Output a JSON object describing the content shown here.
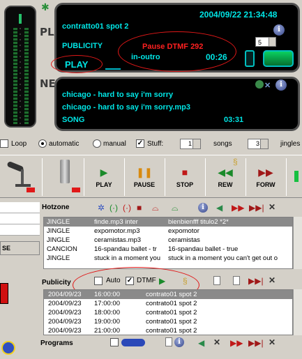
{
  "side_label_top": "PLAY",
  "side_label_bottom": "NEXT",
  "current": {
    "title": "contratto01 spot 2",
    "datetime": "2004/09/22 21:34:48",
    "category": "PUBLICITY",
    "status_alert": "Pause DTMF 292",
    "mode": "in-outro",
    "time": "00:26",
    "state": "PLAY",
    "spin_value": "5"
  },
  "next": {
    "title": "chicago - hard to say i'm sorry",
    "file": "chicago - hard to say i'm sorry.mp3",
    "category": "SONG",
    "time": "03:31"
  },
  "options": {
    "loop": "Loop",
    "automatic": "automatic",
    "manual": "manual",
    "stuff": "Stuff:",
    "songs_value": "1",
    "songs_label": "songs",
    "jingles_value": "3",
    "jingles_label": "jingles"
  },
  "transport": {
    "play": "PLAY",
    "pause": "PAUSE",
    "stop": "STOP",
    "rew": "REW",
    "forw": "FORW"
  },
  "left_panel": {
    "button": "SE"
  },
  "hotzone": {
    "title": "Hotzone",
    "rows": [
      {
        "type": "JINGLE",
        "file": "finde.mp3 inter",
        "title": "bienbienfff titulo2 *2*"
      },
      {
        "type": "JINGLE",
        "file": "expomotor.mp3",
        "title": "expomotor"
      },
      {
        "type": "JINGLE",
        "file": "ceramistas.mp3",
        "title": "ceramistas"
      },
      {
        "type": "CANCION",
        "file": "16-spandau ballet - tr",
        "title": "16-spandau ballet - true"
      },
      {
        "type": "JINGLE",
        "file": "stuck in a moment you",
        "title": "stuck in a moment you can't get out o"
      }
    ]
  },
  "publicity": {
    "title": "Publicity",
    "auto_label": "Auto",
    "dtmf_label": "DTMF",
    "rows": [
      {
        "date": "2004/09/23",
        "time": "16:00:00",
        "title": "contrato01 spot 2"
      },
      {
        "date": "2004/09/23",
        "time": "17:00:00",
        "title": "contrato01 spot 2"
      },
      {
        "date": "2004/09/23",
        "time": "18:00:00",
        "title": "contrato01 spot 2"
      },
      {
        "date": "2004/09/23",
        "time": "19:00:00",
        "title": "contrato01 spot 2"
      },
      {
        "date": "2004/09/23",
        "time": "21:00:00",
        "title": "contrato01 spot 2"
      }
    ]
  },
  "programs": {
    "title": "Programs"
  },
  "colors": {
    "display_text": "#00e5e5",
    "alert": "#ff2020",
    "play_green": "#1a8a2a",
    "stop_red": "#c01818"
  }
}
